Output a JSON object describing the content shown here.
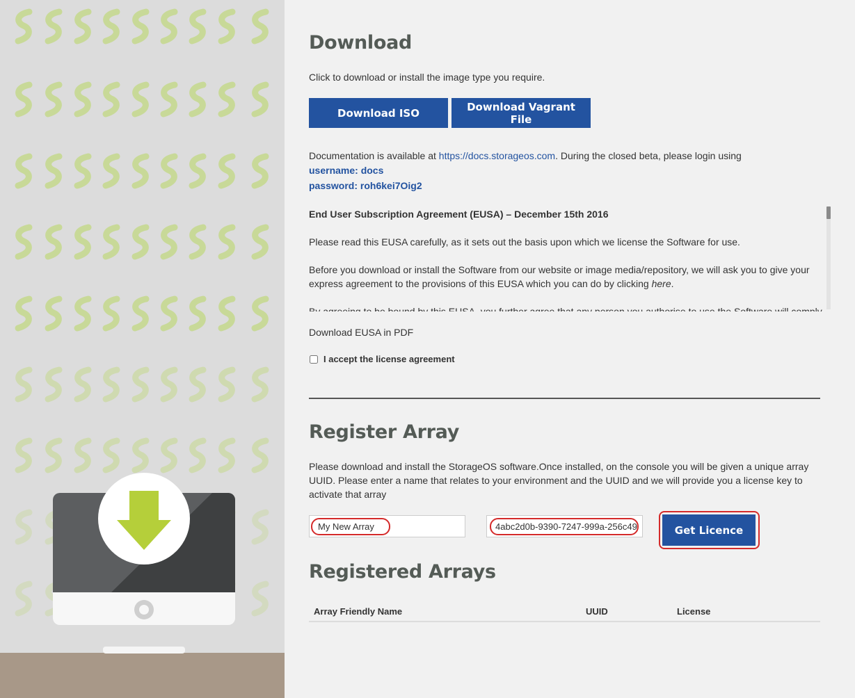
{
  "download": {
    "title": "Download",
    "intro": "Click to download or install the image type you require.",
    "iso_button": "Download ISO",
    "vagrant_button": "Download Vagrant File",
    "docs_prefix": "Documentation is available at ",
    "docs_link": "https://docs.storageos.com",
    "docs_suffix": ". During the closed beta, please login using",
    "username": "username: docs",
    "password": "password: roh6kei7Oig2"
  },
  "eusa": {
    "title": "End User Subscription Agreement (EUSA) – December 15th 2016",
    "para1": "Please read this EUSA carefully, as it sets out the basis upon which we license the Software for use.",
    "para2_prefix": "Before you download or install the Software from our website or image media/repository, we will ask you to give your express agreement to the provisions of this EUSA which you can do by clicking ",
    "para2_link": "here",
    "para2_suffix": ".",
    "para3": "By agreeing to be bound by this EUSA, you further agree that any person you authorise to use the Software will comply",
    "pdf_link": "Download EUSA in PDF",
    "accept_label": "I accept the license agreement",
    "accepted": false
  },
  "register": {
    "title": "Register Array",
    "description": "Please download and install the StorageOS software.Once installed, on the console you will be given a unique array UUID. Please enter a name that relates to your environment and the UUID and we will provide you a license key to activate that array",
    "name_value": "My New Array",
    "uuid_value": "4abc2d0b-9390-7247-999a-256c49",
    "button": "Get Licence"
  },
  "registered": {
    "title": "Registered Arrays",
    "columns": [
      "Array Friendly Name",
      "UUID",
      "License"
    ],
    "rows": []
  },
  "colors": {
    "accent": "#2353a0",
    "heading": "#545b56",
    "highlight": "#d42a2a",
    "pattern_green": "#c4d88c",
    "arrow_green": "#b5cf3a",
    "floor": "#a89888"
  },
  "icons": {
    "hero": "monitor-download-icon"
  }
}
